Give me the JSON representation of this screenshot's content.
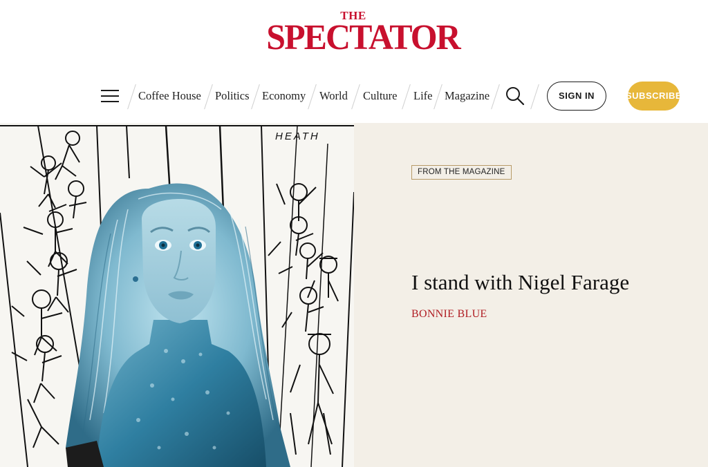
{
  "brand": {
    "the": "THE",
    "name": "SPECTATOR",
    "color": "#c8102e"
  },
  "nav": {
    "menu_icon": "hamburger-menu-icon",
    "links": [
      "Coffee House",
      "Politics",
      "Economy",
      "World",
      "Culture",
      "Life",
      "Magazine"
    ],
    "search_icon": "search-icon",
    "signin_label": "SIGN IN",
    "subscribe_label": "SUBSCRIBE",
    "subscribe_color": "#e7b73a"
  },
  "article": {
    "badge": "FROM THE MAGAZINE",
    "headline": "I stand with Nigel Farage",
    "author": "BONNIE BLUE",
    "author_color": "#b01d23",
    "panel_color": "#f3efe7",
    "illustration_signature": "HEATH"
  }
}
